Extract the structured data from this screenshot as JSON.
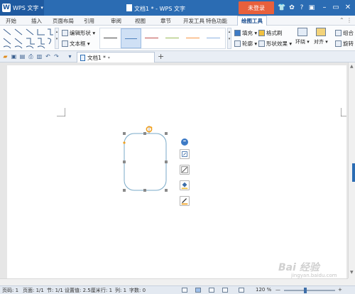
{
  "titlebar": {
    "app_name": "WPS 文字",
    "logo_letter": "W",
    "window_title": "文档1 * - WPS 文字",
    "login_label": "未登录",
    "icons": [
      "shirt-icon",
      "chat-icon",
      "help-icon",
      "ribbon-collapse-icon"
    ],
    "window_buttons": [
      "minimize-icon",
      "maximize-icon",
      "close-icon"
    ]
  },
  "tabs": [
    "开始",
    "插入",
    "页面布局",
    "引用",
    "审阅",
    "视图",
    "章节",
    "开发工具",
    "特色功能",
    "绘图工具"
  ],
  "active_tab": "绘图工具",
  "ribbon": {
    "edit_shape": "编辑形状 ▾",
    "text_box": "文本框 ▾",
    "fill": "填充 ▾",
    "format_brush": "格式刷",
    "outline": "轮廓 ▾",
    "shape_effect": "形状效果 ▾",
    "wrap": "环绕 ▾",
    "align": "对齐 ▾",
    "group": "组合",
    "rotate": "旋转",
    "shape_style_colors": [
      "#4a4a4a",
      "#4f81bd",
      "#c0504d",
      "#9bbb59",
      "#f79646",
      "#8db3e2"
    ]
  },
  "doc_tab": {
    "label": "文档1 *",
    "new_tab": "+"
  },
  "statusbar": {
    "page_num": "页码: 1",
    "page": "页面: 1/1",
    "section": "节: 1/1",
    "setting": "设置值: 2.5厘米",
    "row": "行: 1",
    "col": "列: 1",
    "word_count": "字数: 0",
    "zoom": "120 %",
    "zoom_minus": "—",
    "zoom_plus": "+",
    "zoom_level_fraction": 0.42
  },
  "watermark": {
    "brand": "Bai 经验",
    "url": "jingyan.baidu.com"
  }
}
